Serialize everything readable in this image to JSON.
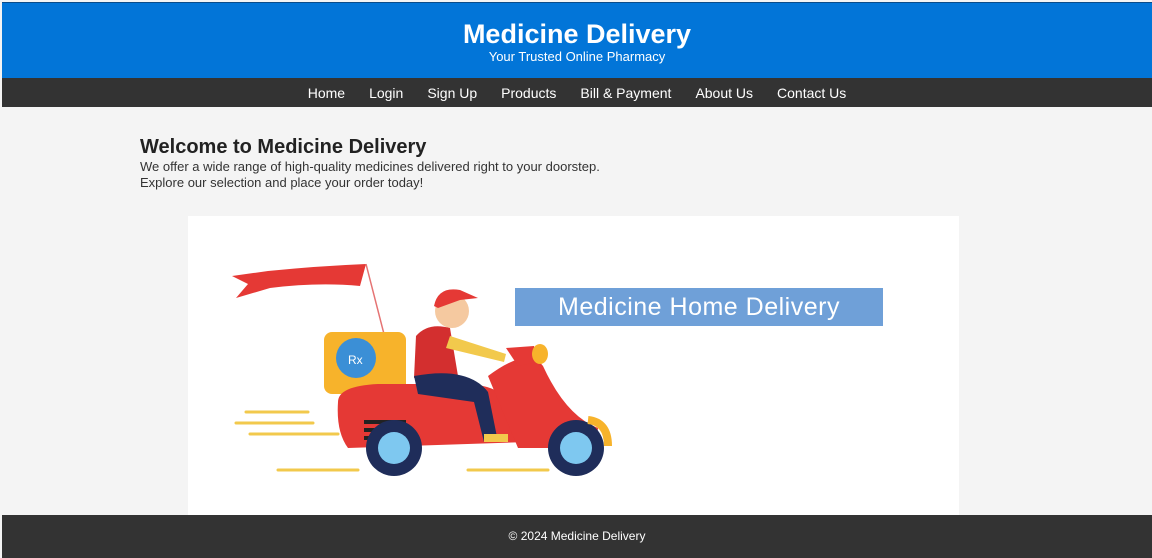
{
  "header": {
    "title": "Medicine Delivery",
    "tagline": "Your Trusted Online Pharmacy"
  },
  "nav": {
    "items": [
      "Home",
      "Login",
      "Sign Up",
      "Products",
      "Bill & Payment",
      "About Us",
      "Contact Us"
    ]
  },
  "main": {
    "heading": "Welcome to Medicine Delivery",
    "line1": "We offer a wide range of high-quality medicines delivered right to your doorstep.",
    "line2": "Explore our selection and place your order today!"
  },
  "hero": {
    "banner_text": "Medicine Home Delivery",
    "rx_text": "Rx"
  },
  "footer": {
    "text": "© 2024 Medicine Delivery"
  },
  "colors": {
    "header_bg": "#0275d8",
    "nav_bg": "#333333",
    "footer_bg": "#333333",
    "banner_bg": "#6fa0d8",
    "scooter_red": "#e53935",
    "box_orange": "#f7b32b"
  }
}
